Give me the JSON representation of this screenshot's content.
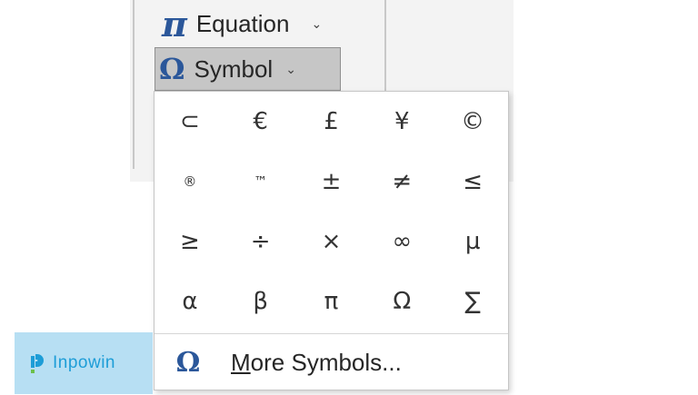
{
  "ribbon": {
    "equation": {
      "icon": "π",
      "label": "Equation",
      "chevron": "⌄"
    },
    "symbol": {
      "icon": "Ω",
      "label": "Symbol",
      "chevron": "⌄"
    }
  },
  "dropdown": {
    "symbols": [
      "⊂",
      "€",
      "£",
      "¥",
      "©",
      "®",
      "™",
      "±",
      "≠",
      "≤",
      "≥",
      "÷",
      "×",
      "∞",
      "µ",
      "α",
      "β",
      "π",
      "Ω",
      "∑"
    ],
    "more_icon": "Ω",
    "more_first": "M",
    "more_rest": "ore Symbols..."
  },
  "watermark": {
    "text": "Inpowin"
  },
  "colors": {
    "accent": "#2b579a",
    "watermark_bg": "#b7dff3",
    "watermark_text": "#1d9dd7"
  }
}
